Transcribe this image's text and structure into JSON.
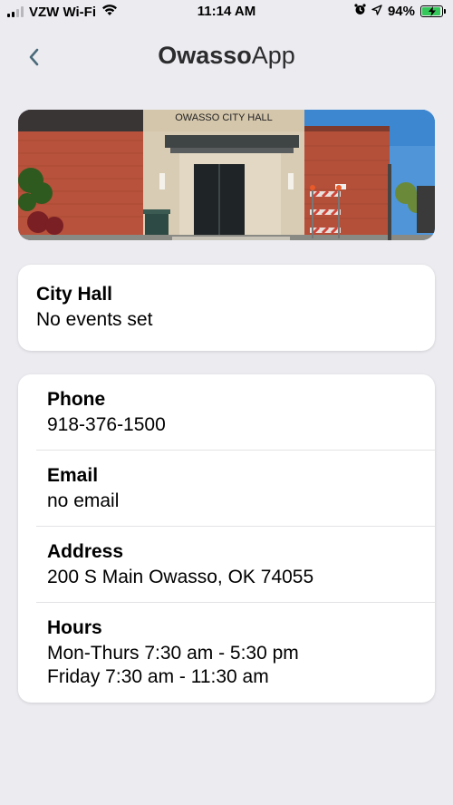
{
  "status_bar": {
    "carrier": "VZW Wi-Fi",
    "time": "11:14 AM",
    "battery": "94%",
    "battery_level": 0.94,
    "battery_color": "#34c759"
  },
  "nav": {
    "back_icon": "chevron-left-icon",
    "title_bold": "Owasso",
    "title_light": "App"
  },
  "hero": {
    "sign_text": "OWASSO CITY HALL"
  },
  "summary": {
    "title": "City Hall",
    "subtitle": "No events set"
  },
  "info": {
    "phone_label": "Phone",
    "phone_value": "918-376-1500",
    "email_label": "Email",
    "email_value": "no email",
    "address_label": "Address",
    "address_value": "200 S Main Owasso, OK 74055",
    "hours_label": "Hours",
    "hours_line1": "Mon-Thurs 7:30 am - 5:30 pm",
    "hours_line2": "Friday 7:30 am - 11:30 am"
  },
  "colors": {
    "background": "#ebebf0",
    "accent": "#4a6a7a"
  }
}
